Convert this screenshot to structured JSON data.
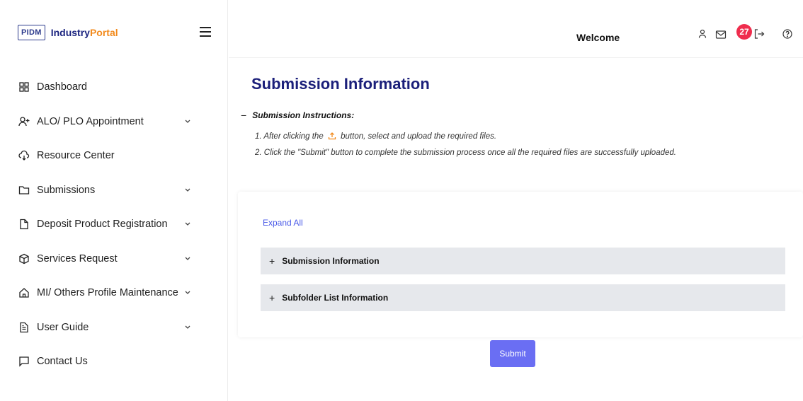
{
  "brand": {
    "logo_text": "PIDM",
    "name_part1": "Industry",
    "name_part2": "Portal"
  },
  "sidebar": {
    "items": [
      {
        "label": "Dashboard",
        "icon": "grid-icon",
        "has_chevron": false
      },
      {
        "label": "ALO/ PLO Appointment",
        "icon": "user-plus-icon",
        "has_chevron": true
      },
      {
        "label": "Resource Center",
        "icon": "cloud-download-icon",
        "has_chevron": false
      },
      {
        "label": "Submissions",
        "icon": "folder-icon",
        "has_chevron": true
      },
      {
        "label": "Deposit Product Registration",
        "icon": "file-icon",
        "has_chevron": true
      },
      {
        "label": "Services Request",
        "icon": "box-icon",
        "has_chevron": true
      },
      {
        "label": "MI/ Others Profile Maintenance",
        "icon": "home-icon",
        "has_chevron": true
      },
      {
        "label": "User Guide",
        "icon": "document-icon",
        "has_chevron": true
      },
      {
        "label": "Contact Us",
        "icon": "message-icon",
        "has_chevron": false
      }
    ]
  },
  "header": {
    "welcome": "Welcome",
    "mail_count": "27"
  },
  "main": {
    "title": "Submission Information",
    "instructions_heading": "Submission Instructions:",
    "instruction_1_pre": "1. After clicking the",
    "instruction_1_post": "button, select and upload the required files.",
    "instruction_2": "2. Click the \"Submit\" button to complete the submission process once all the required files are successfully uploaded.",
    "expand_all": "Expand All",
    "accordions": [
      {
        "label": "Submission Information"
      },
      {
        "label": "Subfolder List Information"
      }
    ],
    "submit_label": "Submit"
  },
  "colors": {
    "title": "#1b1f7a",
    "brand_orange": "#f28a1c",
    "badge": "#ef2d4d",
    "primary_button": "#6a6ef3",
    "link": "#4a5ae8"
  }
}
